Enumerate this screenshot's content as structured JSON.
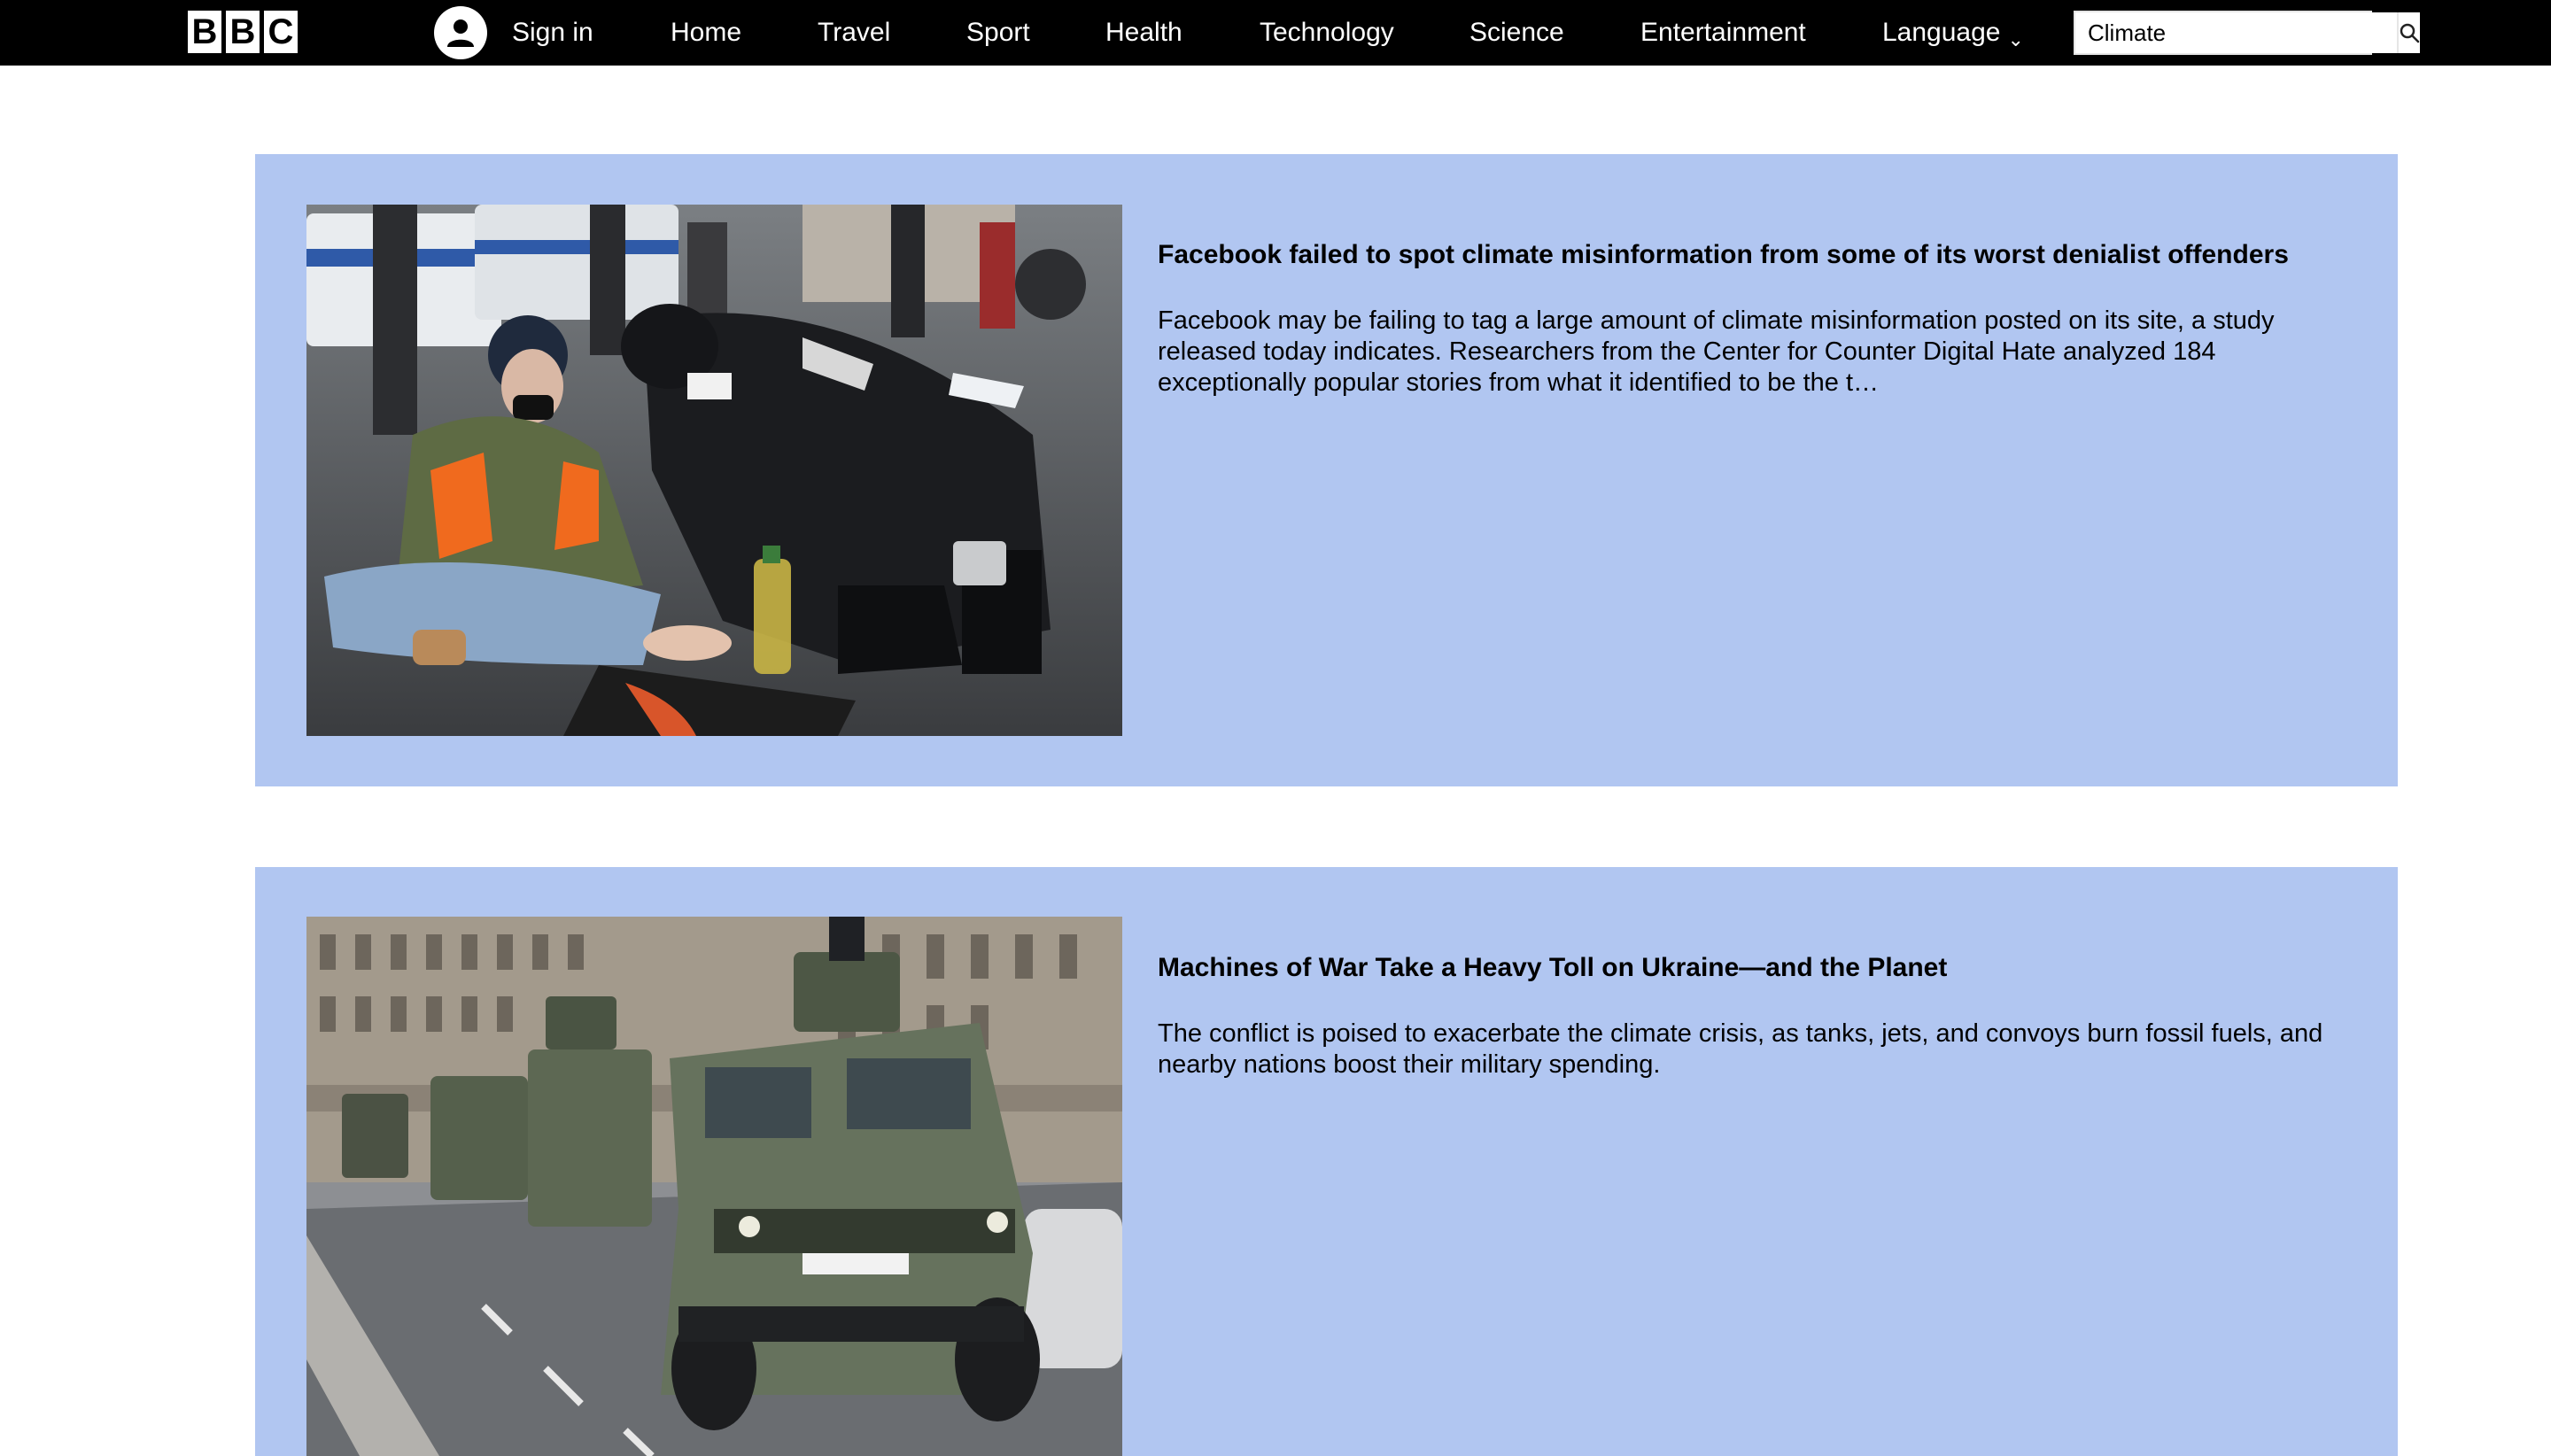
{
  "header": {
    "logo_letters": [
      "B",
      "B",
      "C"
    ],
    "sign_in_label": "Sign in",
    "nav_items": [
      "Home",
      "Travel",
      "Sport",
      "Health",
      "Technology",
      "Science",
      "Entertainment",
      "Language"
    ],
    "search": {
      "value": "Climate"
    },
    "icons": {
      "account": "user-icon",
      "search": "search-icon",
      "language_menu": "chevron-down-icon"
    }
  },
  "articles": [
    {
      "title": "Facebook failed to spot climate misinformation from some of its worst denialist offenders",
      "summary": "Facebook may be failing to tag a large amount of climate misinformation posted on its site, a study released today indicates. Researchers from the Center for Counter Digital Hate analyzed 184 exceptionally popular stories from what it identified to be the t…"
    },
    {
      "title": "Machines of War Take a Heavy Toll on Ukraine—and the Planet",
      "summary": "The conflict is poised to exacerbate the climate crisis, as tanks, jets, and convoys burn fossil fuels, and nearby nations boost their military spending."
    }
  ],
  "colors": {
    "topbar": "#000000",
    "card_background": "#b1c6f1",
    "page_background": "#ffffff"
  }
}
